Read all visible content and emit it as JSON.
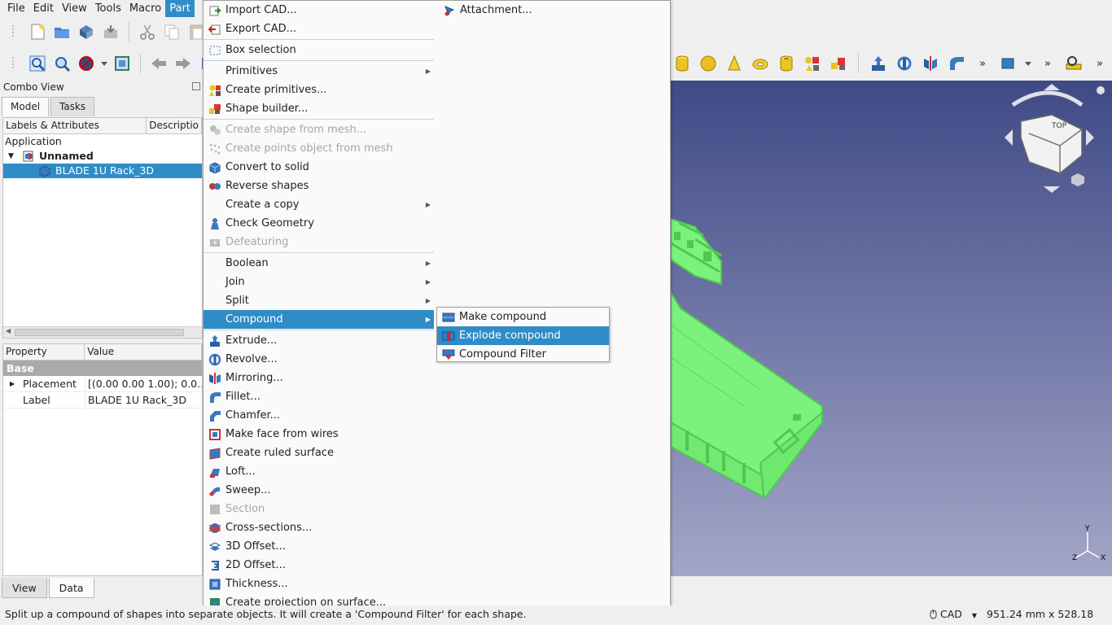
{
  "menubar": {
    "items": [
      "File",
      "Edit",
      "View",
      "Tools",
      "Macro",
      "Part"
    ],
    "active": "Part"
  },
  "combo": {
    "title": "Combo View",
    "tabs": [
      "Model",
      "Tasks"
    ],
    "tree_headers": [
      "Labels & Attributes",
      "Descriptio"
    ],
    "tree": {
      "root": "Application",
      "document": "Unnamed",
      "object": "BLADE 1U Rack_3D"
    },
    "prop_headers": [
      "Property",
      "Value"
    ],
    "prop_group": "Base",
    "props": [
      {
        "key": "Placement",
        "value": "[(0.00 0.00 1.00); 0.0..."
      },
      {
        "key": "Label",
        "value": "BLADE 1U Rack_3D"
      }
    ],
    "bottom_tabs": [
      "View",
      "Data"
    ]
  },
  "part_menu": {
    "items": [
      {
        "label": "Import CAD...",
        "icon": "import-icon"
      },
      {
        "label": "Export CAD...",
        "icon": "export-icon"
      },
      {
        "label": "Box selection",
        "icon": "box-selection-icon"
      },
      {
        "label": "Primitives"
      },
      {
        "label": "Create primitives...",
        "icon": "primitives-icon"
      },
      {
        "label": "Shape builder...",
        "icon": "shape-builder-icon"
      },
      {
        "label": "Create shape from mesh...",
        "icon": "mesh-shape-icon"
      },
      {
        "label": "Create points object from mesh",
        "icon": "mesh-points-icon"
      },
      {
        "label": "Convert to solid",
        "icon": "solid-icon"
      },
      {
        "label": "Reverse shapes",
        "icon": "reverse-icon"
      },
      {
        "label": "Create a copy"
      },
      {
        "label": "Check Geometry",
        "icon": "check-geometry-icon"
      },
      {
        "label": "Defeaturing",
        "icon": "defeaturing-icon"
      },
      {
        "label": "Boolean"
      },
      {
        "label": "Join"
      },
      {
        "label": "Split"
      },
      {
        "label": "Compound"
      },
      {
        "label": "Extrude...",
        "icon": "extrude-icon"
      },
      {
        "label": "Revolve...",
        "icon": "revolve-icon"
      },
      {
        "label": "Mirroring...",
        "icon": "mirror-icon"
      },
      {
        "label": "Fillet...",
        "icon": "fillet-icon"
      },
      {
        "label": "Chamfer...",
        "icon": "chamfer-icon"
      },
      {
        "label": "Make face from wires",
        "icon": "face-icon"
      },
      {
        "label": "Create ruled surface",
        "icon": "ruled-surface-icon"
      },
      {
        "label": "Loft...",
        "icon": "loft-icon"
      },
      {
        "label": "Sweep...",
        "icon": "sweep-icon"
      },
      {
        "label": "Section",
        "icon": "section-icon"
      },
      {
        "label": "Cross-sections...",
        "icon": "cross-sections-icon"
      },
      {
        "label": "3D Offset...",
        "icon": "offset3d-icon"
      },
      {
        "label": "2D Offset...",
        "icon": "offset2d-icon"
      },
      {
        "label": "Thickness...",
        "icon": "thickness-icon"
      },
      {
        "label": "Create projection on surface...",
        "icon": "projection-icon"
      }
    ],
    "attachment": "Attachment..."
  },
  "compound_menu": {
    "items": [
      "Make compound",
      "Explode compound",
      "Compound Filter"
    ]
  },
  "colors": {
    "highlight": "#308cc6",
    "model_green": "#7cf27c",
    "view_top": "#3f4a86",
    "view_bottom": "#a4a6c8"
  },
  "status": {
    "message": "Split up a compound of shapes into separate objects. It will create a 'Compound Filter' for each shape.",
    "nav_style": "CAD",
    "dimensions": "951.24 mm x 528.18 mm"
  }
}
